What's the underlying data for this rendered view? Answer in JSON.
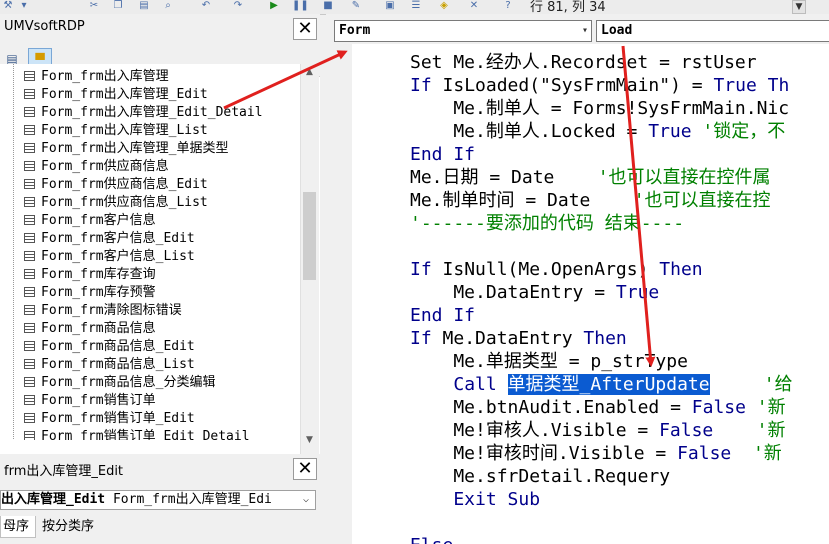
{
  "toolbar": {
    "status_text": "行 81, 列 34",
    "icons": [
      "wrench-icon",
      "cut-icon",
      "copy-icon",
      "paste-icon",
      "find-icon",
      "undo-icon",
      "redo-icon",
      "run-icon",
      "break-icon",
      "reset-icon",
      "design-mode-icon",
      "project-explorer-icon",
      "properties-icon",
      "object-browser-icon",
      "toolbox-icon",
      "help-icon"
    ]
  },
  "project": {
    "title": "UMVsoftRDP",
    "close": "✕",
    "items": [
      "Form_frm出入库管理",
      "Form_frm出入库管理_Edit",
      "Form_frm出入库管理_Edit_Detail",
      "Form_frm出入库管理_List",
      "Form_frm出入库管理_单据类型",
      "Form_frm供应商信息",
      "Form_frm供应商信息_Edit",
      "Form_frm供应商信息_List",
      "Form_frm客户信息",
      "Form_frm客户信息_Edit",
      "Form_frm客户信息_List",
      "Form_frm库存查询",
      "Form_frm库存预警",
      "Form_frm清除图标错误",
      "Form_frm商品信息",
      "Form_frm商品信息_Edit",
      "Form_frm商品信息_List",
      "Form_frm商品信息_分类编辑",
      "Form_frm销售订单",
      "Form_frm销售订单_Edit",
      "Form_frm销售订单_Edit_Detail"
    ]
  },
  "properties": {
    "title": "frm出入库管理_Edit",
    "close": "✕",
    "object_bold": "出入库管理_Edit",
    "object_type": "Form_frm出入库管理_Edi",
    "tabs": [
      "母序",
      "按分类序"
    ]
  },
  "code": {
    "object_combo": "Form",
    "proc_combo": "Load",
    "lines": [
      [
        {
          "t": "Set Me.经办人.Recordset = rstUser",
          "c": ""
        }
      ],
      [
        {
          "t": "If ",
          "c": "kw"
        },
        {
          "t": "IsLoaded(\"SysFrmMain\") = ",
          "c": ""
        },
        {
          "t": "True Th",
          "c": "kw"
        }
      ],
      [
        {
          "t": "    Me.制单人 = Forms!SysFrmMain.Nic",
          "c": ""
        }
      ],
      [
        {
          "t": "    Me.制单人.Locked = ",
          "c": ""
        },
        {
          "t": "True",
          "c": "kw"
        },
        {
          "t": " '锁定，不",
          "c": "cm"
        }
      ],
      [
        {
          "t": "End If",
          "c": "kw"
        }
      ],
      [
        {
          "t": "Me.日期 = Date    ",
          "c": ""
        },
        {
          "t": "'也可以直接在控件属",
          "c": "cm"
        }
      ],
      [
        {
          "t": "Me.制单时间 = Date    ",
          "c": ""
        },
        {
          "t": "'也可以直接在控",
          "c": "cm"
        }
      ],
      [
        {
          "t": "'------要添加的代码 结束----",
          "c": "cm"
        }
      ],
      [],
      [
        {
          "t": "If ",
          "c": "kw"
        },
        {
          "t": "IsNull(Me.OpenArgs) ",
          "c": ""
        },
        {
          "t": "Then",
          "c": "kw"
        }
      ],
      [
        {
          "t": "    Me.DataEntry = ",
          "c": ""
        },
        {
          "t": "True",
          "c": "kw"
        }
      ],
      [
        {
          "t": "End If",
          "c": "kw"
        }
      ],
      [
        {
          "t": "If ",
          "c": "kw"
        },
        {
          "t": "Me.DataEntry ",
          "c": ""
        },
        {
          "t": "Then",
          "c": "kw"
        }
      ],
      [
        {
          "t": "    Me.单据类型 = p_strType",
          "c": ""
        }
      ],
      [
        {
          "t": "    ",
          "c": ""
        },
        {
          "t": "Call ",
          "c": "kw"
        },
        {
          "t": "单据类型_AfterUpdate",
          "c": "sel"
        },
        {
          "t": "     ",
          "c": ""
        },
        {
          "t": "'给",
          "c": "cm"
        }
      ],
      [
        {
          "t": "    Me.btnAudit.Enabled = ",
          "c": ""
        },
        {
          "t": "False",
          "c": "kw"
        },
        {
          "t": " '新",
          "c": "cm"
        }
      ],
      [
        {
          "t": "    Me!审核人.Visible = ",
          "c": ""
        },
        {
          "t": "False",
          "c": "kw"
        },
        {
          "t": "    '新",
          "c": "cm"
        }
      ],
      [
        {
          "t": "    Me!审核时间.Visible = ",
          "c": ""
        },
        {
          "t": "False",
          "c": "kw"
        },
        {
          "t": "  '新",
          "c": "cm"
        }
      ],
      [
        {
          "t": "    Me.sfrDetail.Requery",
          "c": ""
        }
      ],
      [
        {
          "t": "    Exit Sub",
          "c": "kw"
        }
      ],
      [],
      [
        {
          "t": "Else",
          "c": "kw"
        }
      ]
    ]
  }
}
